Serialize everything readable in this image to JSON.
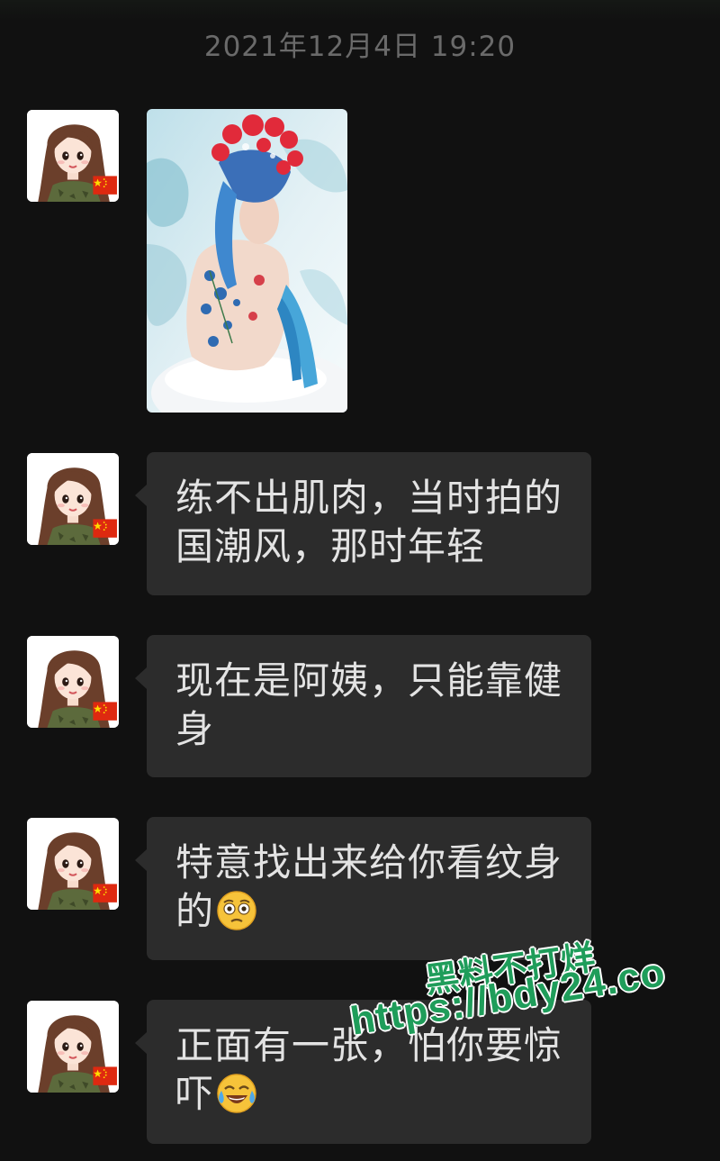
{
  "timestamp": "2021年12月4日 19:20",
  "colors": {
    "background": "#111111",
    "bubble": "#2c2c2c",
    "bubble_text": "#e3e3e3",
    "timestamp_text": "#6a6a6a",
    "watermark": "#1f9d5a"
  },
  "messages": [
    {
      "type": "image",
      "avatar": "girl-avatar-icon"
    },
    {
      "type": "text",
      "avatar": "girl-avatar-icon",
      "lines": [
        "练不出肌肉，当时拍的",
        "国潮风，那时年轻"
      ]
    },
    {
      "type": "text",
      "avatar": "girl-avatar-icon",
      "lines": [
        "现在是阿姨，只能靠健",
        "身"
      ]
    },
    {
      "type": "text",
      "avatar": "girl-avatar-icon",
      "lines": [
        "特意找出来给你看纹身",
        "的"
      ],
      "emoji": "flushed-face-icon"
    },
    {
      "type": "text",
      "avatar": "girl-avatar-icon",
      "lines": [
        "正面有一张，怕你要惊",
        "吓"
      ],
      "emoji": "tears-of-joy-face-icon"
    }
  ],
  "watermark": {
    "line1": "黑料不打烊",
    "line2": "https://bdy24.co"
  }
}
